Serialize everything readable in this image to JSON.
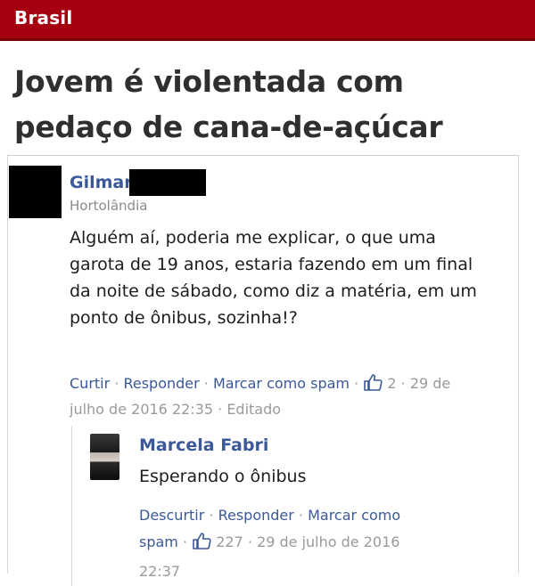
{
  "section": {
    "label": "Brasil"
  },
  "article": {
    "title": "Jovem é violentada com pedaço de cana-de-açúcar"
  },
  "comment": {
    "author": "Gilmar",
    "location": "Hortolândia",
    "text": "Alguém aí, poderia me explicar, o que uma garota de 19 anos, estaria fazendo em um final da noite de sábado, como diz a matéria, em um ponto de ônibus, sozinha!?",
    "actions": {
      "like": "Curtir",
      "reply": "Responder",
      "spam": "Marcar como spam"
    },
    "likes": "2",
    "timestamp": "29 de julho de 2016 22:35",
    "edited": "Editado"
  },
  "reply": {
    "author": "Marcela Fabri",
    "text": "Esperando o ônibus",
    "actions": {
      "like": "Descurtir",
      "reply": "Responder",
      "spam": "Marcar como spam"
    },
    "likes": "227",
    "timestamp": "29 de julho de 2016 22:37"
  },
  "colors": {
    "header_bg": "#a50010",
    "link": "#3b5998",
    "meta": "#9a9a9a"
  }
}
